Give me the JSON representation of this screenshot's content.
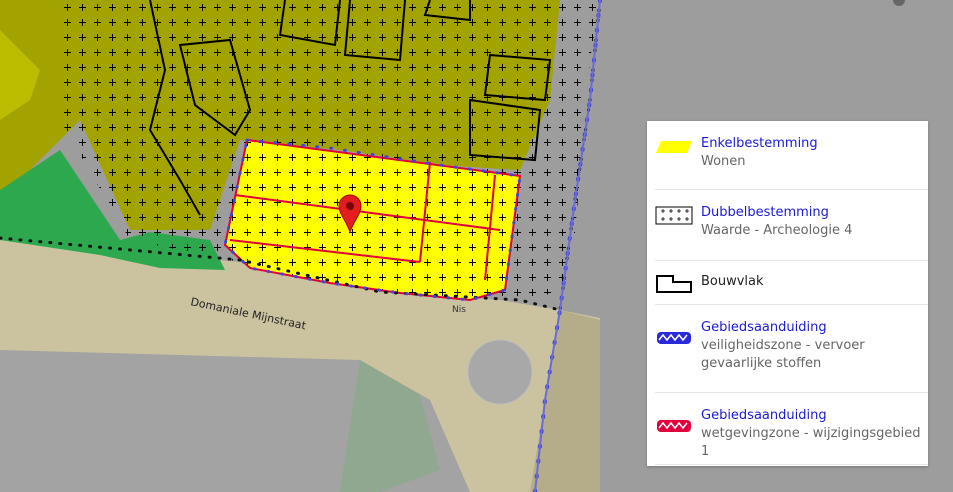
{
  "map": {
    "street_label": "Domaniale Mijnstraat",
    "street_label_2": "Nis",
    "colors": {
      "background": "#9d9d9d",
      "olive": "#a3a300",
      "yellow": "#ffff00",
      "green": "#2da84f",
      "road": "#cfc6a2",
      "blue_line": "#3a3ad0",
      "red_line": "#e0003c"
    },
    "marker_icon": "location-pin-icon"
  },
  "legend": {
    "items": [
      {
        "title": "Enkelbestemming",
        "subtitle": "Wonen",
        "icon": "yellow-parallelogram-icon",
        "color": "#ffff00"
      },
      {
        "title": "Dubbelbestemming",
        "subtitle": "Waarde - Archeologie 4",
        "icon": "cross-hatch-icon"
      },
      {
        "title": "Bouwvlak",
        "subtitle": "",
        "icon": "building-outline-icon"
      },
      {
        "title": "Gebiedsaanduiding",
        "subtitle": "veiligheidszone - vervoer gevaarlijke stoffen",
        "icon": "blue-zone-icon",
        "color": "#2a2ad8"
      },
      {
        "title": "Gebiedsaanduiding",
        "subtitle": "wetgevingzone - wijzigingsgebied 1",
        "icon": "red-zone-icon",
        "color": "#e0003c"
      }
    ]
  }
}
